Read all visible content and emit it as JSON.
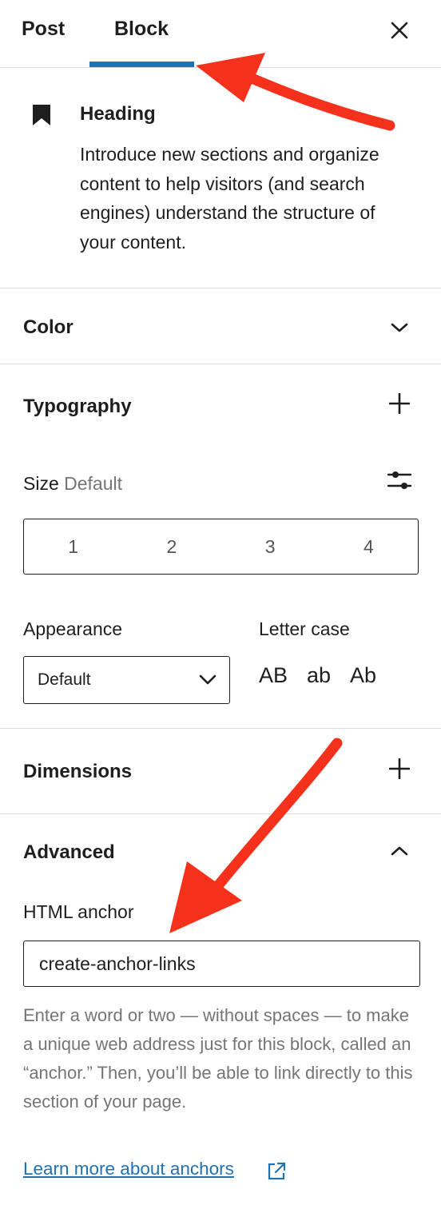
{
  "tabs": {
    "post": "Post",
    "block": "Block"
  },
  "block_card": {
    "title": "Heading",
    "description": "Introduce new sections and organize content to help visitors (and search engines) understand the structure of your content."
  },
  "panels": {
    "color": {
      "title": "Color",
      "icon": "chevron-down-icon"
    },
    "typography": {
      "title": "Typography",
      "icon": "plus-icon",
      "size_label": "Size",
      "size_value": "Default",
      "size_options": [
        "1",
        "2",
        "3",
        "4"
      ],
      "appearance_label": "Appearance",
      "appearance_value": "Default",
      "letter_case_label": "Letter case",
      "letter_case_options": [
        "AB",
        "ab",
        "Ab"
      ]
    },
    "dimensions": {
      "title": "Dimensions",
      "icon": "plus-icon"
    },
    "advanced": {
      "title": "Advanced",
      "icon": "chevron-up-icon",
      "anchor_label": "HTML anchor",
      "anchor_value": "create-anchor-links",
      "help_text": "Enter a word or two — without spaces — to make a unique web address just for this block, called an “anchor.” Then, you’ll be able to link directly to this section of your page.",
      "learn_more": "Learn more about anchors"
    }
  },
  "colors": {
    "accent": "#1b74b8",
    "link": "#2271b1",
    "annotation_arrow": "#f5311b"
  }
}
